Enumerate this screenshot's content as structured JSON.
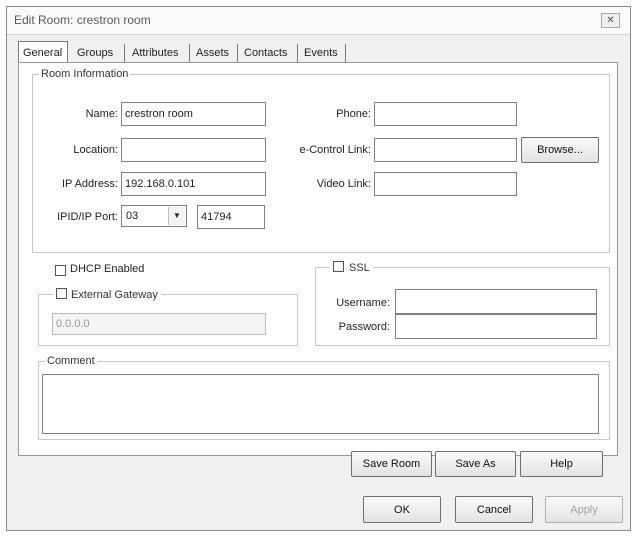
{
  "window": {
    "title": "Edit Room: crestron room",
    "close_glyph": "✕"
  },
  "tabs": [
    {
      "label": "General"
    },
    {
      "label": "Groups"
    },
    {
      "label": "Attributes"
    },
    {
      "label": "Assets"
    },
    {
      "label": "Contacts"
    },
    {
      "label": "Events"
    }
  ],
  "room_info": {
    "legend": "Room Information",
    "name_label": "Name:",
    "name_value": "crestron room",
    "location_label": "Location:",
    "location_value": "",
    "ip_label": "IP Address:",
    "ip_value": "192.168.0.101",
    "ipid_label": "IPID/IP Port:",
    "ipid_value": "03",
    "port_value": "41794",
    "phone_label": "Phone:",
    "phone_value": "",
    "econtrol_label": "e-Control Link:",
    "econtrol_value": "",
    "browse_label": "Browse...",
    "video_label": "Video Link:",
    "video_value": ""
  },
  "network": {
    "dhcp_label": "DHCP Enabled",
    "gateway_label": "External Gateway",
    "gateway_value": "0.0.0.0"
  },
  "ssl": {
    "label": "SSL",
    "username_label": "Username:",
    "username_value": "",
    "password_label": "Password:",
    "password_value": ""
  },
  "comment": {
    "legend": "Comment",
    "value": ""
  },
  "actions": {
    "save_room": "Save Room",
    "save_as": "Save As",
    "help": "Help"
  },
  "footer": {
    "ok": "OK",
    "cancel": "Cancel",
    "apply": "Apply"
  }
}
